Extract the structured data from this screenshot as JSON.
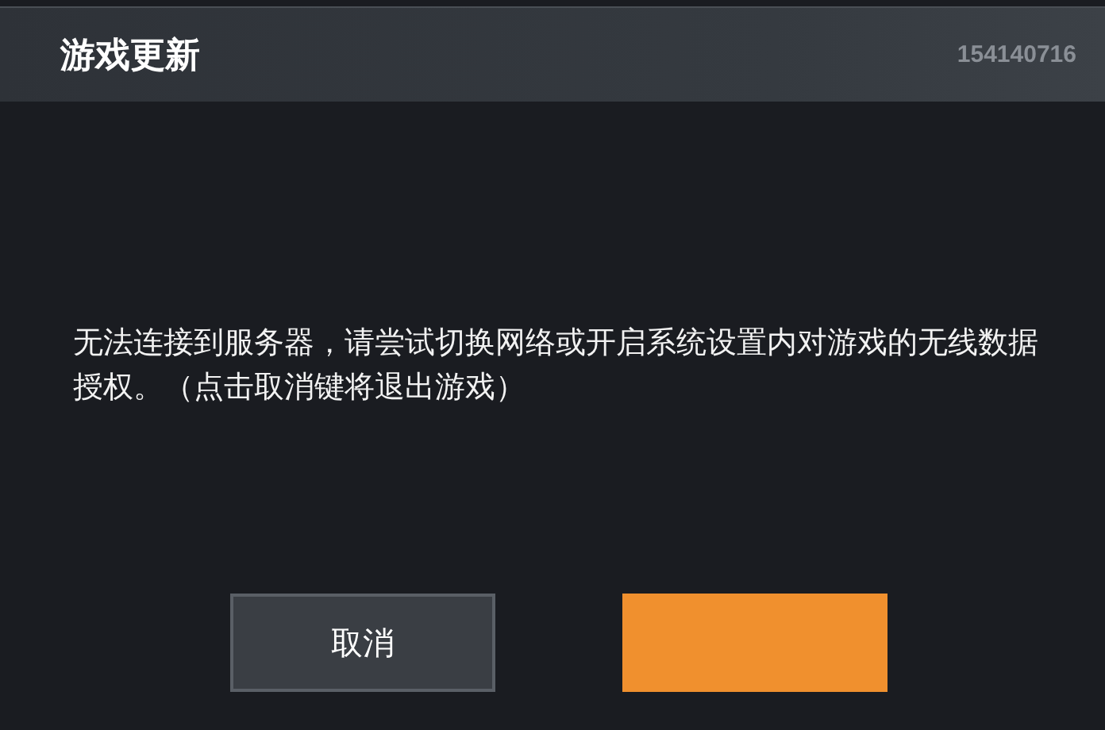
{
  "dialog": {
    "title": "游戏更新",
    "code": "154140716",
    "message": "无法连接到服务器，请尝试切换网络或开启系统设置内对游戏的无线数据授权。（点击取消键将退出游戏）"
  },
  "buttons": [
    {
      "kind": "secondary",
      "label": "取消"
    },
    {
      "kind": "primary"
    }
  ]
}
